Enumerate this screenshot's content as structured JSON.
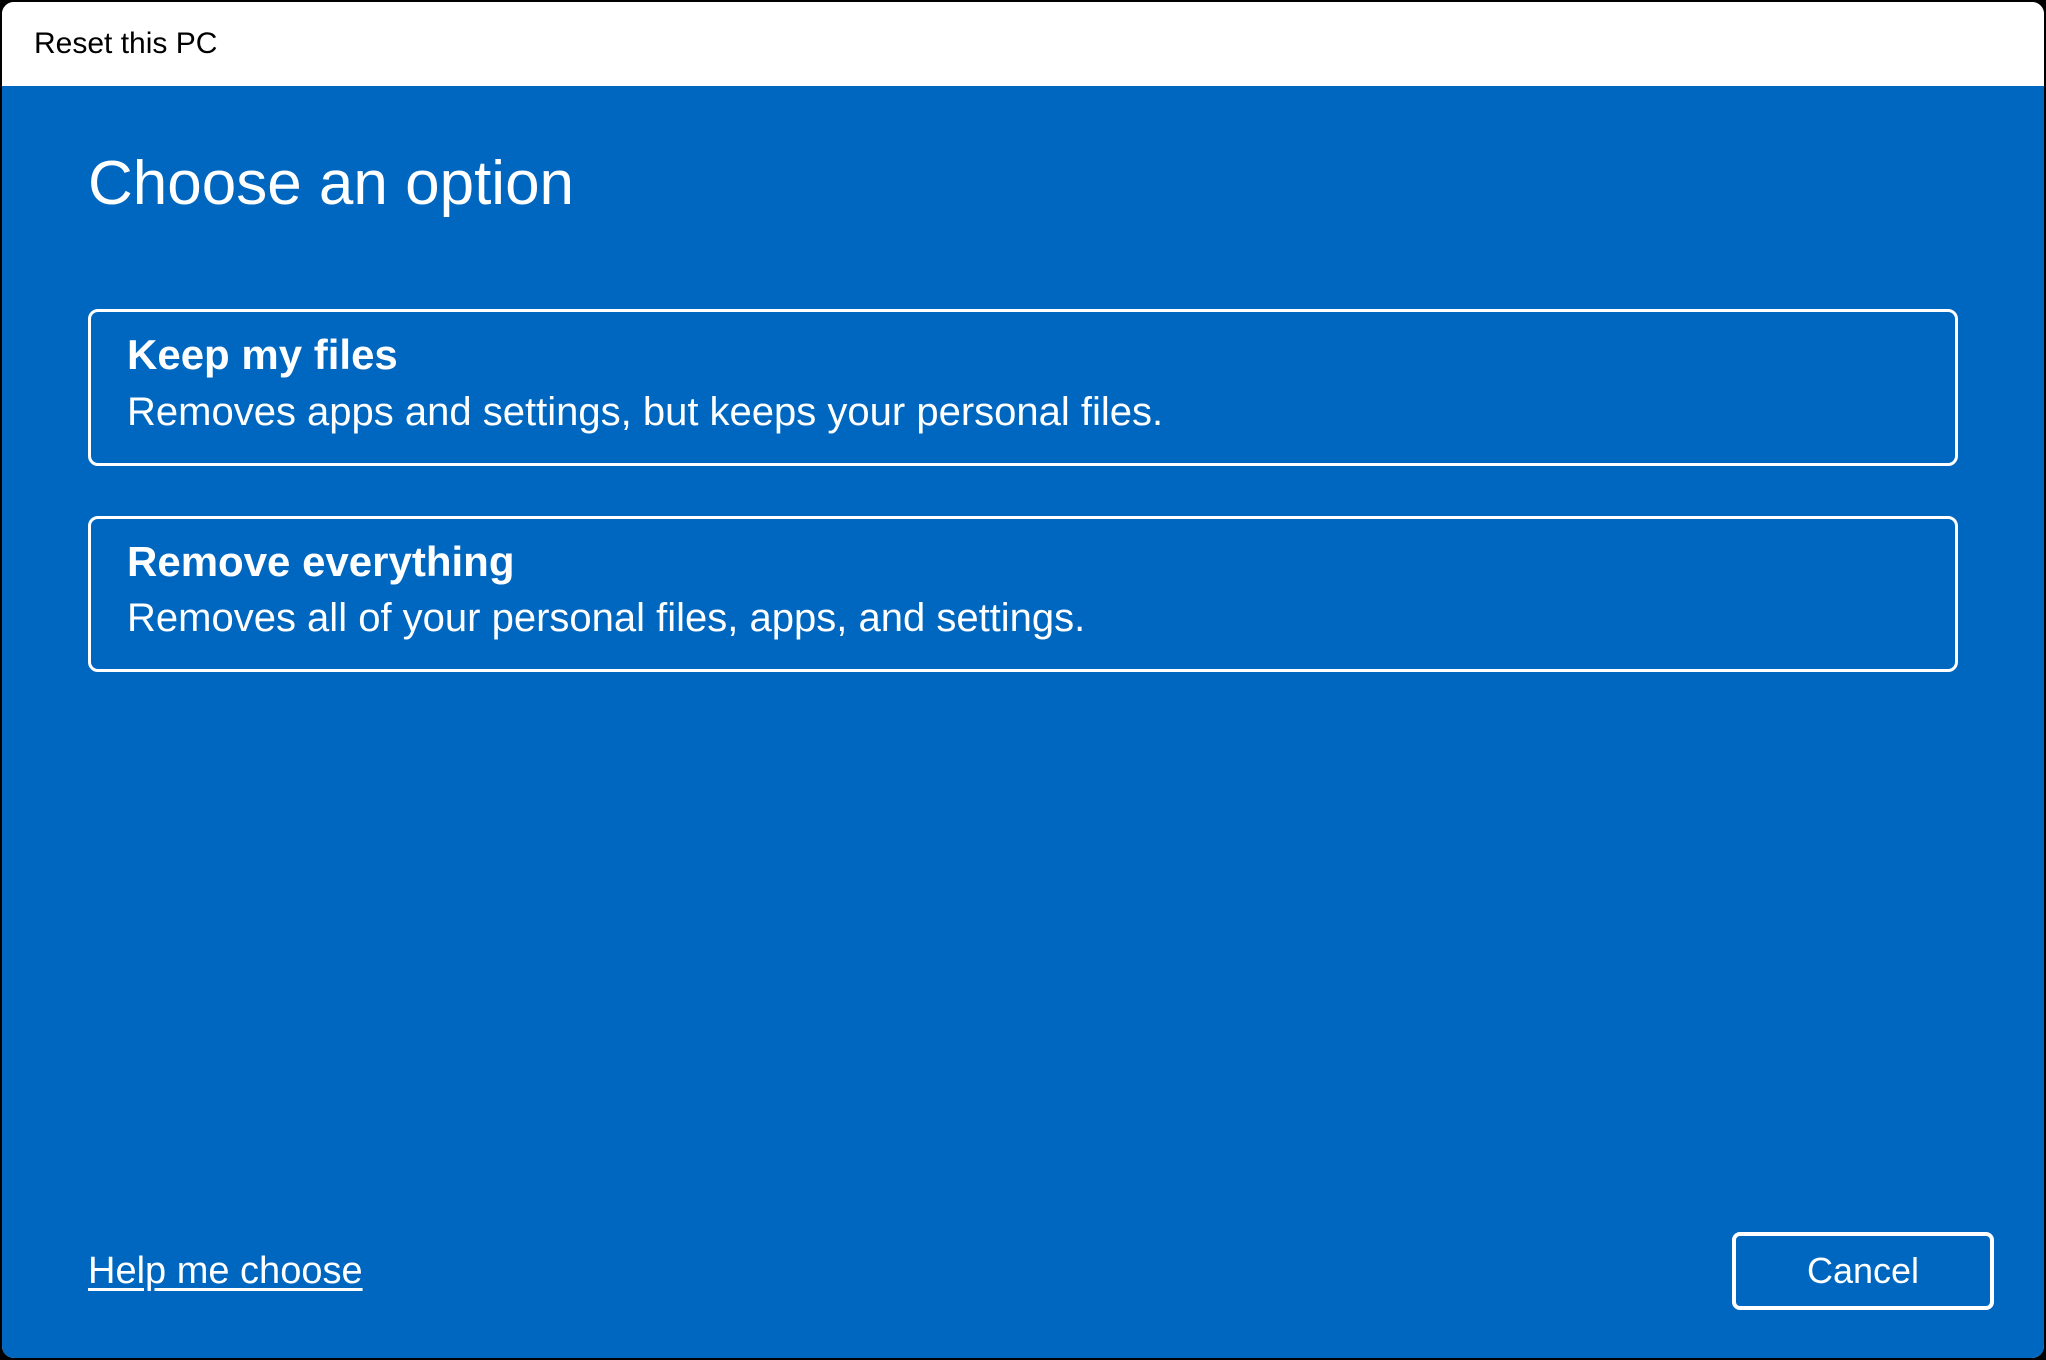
{
  "window": {
    "title": "Reset this PC"
  },
  "page": {
    "heading": "Choose an option"
  },
  "options": [
    {
      "title": "Keep my files",
      "description": "Removes apps and settings, but keeps your personal files."
    },
    {
      "title": "Remove everything",
      "description": "Removes all of your personal files, apps, and settings."
    }
  ],
  "footer": {
    "help_link": "Help me choose",
    "cancel_label": "Cancel"
  },
  "colors": {
    "accent": "#0067c0",
    "text_on_accent": "#ffffff"
  }
}
